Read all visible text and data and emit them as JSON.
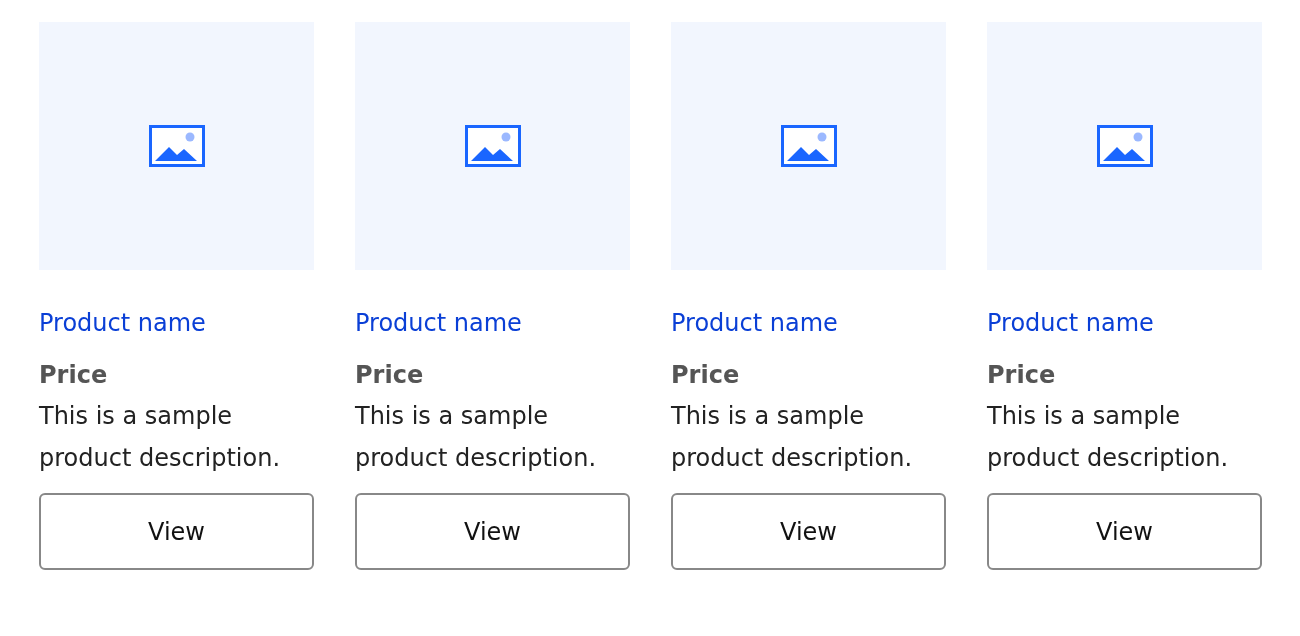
{
  "products": [
    {
      "name": "Product name",
      "price": "Price",
      "description": "This is a sample product description.",
      "button": "View"
    },
    {
      "name": "Product name",
      "price": "Price",
      "description": "This is a sample product description.",
      "button": "View"
    },
    {
      "name": "Product name",
      "price": "Price",
      "description": "This is a sample product description.",
      "button": "View"
    },
    {
      "name": "Product name",
      "price": "Price",
      "description": "This is a sample product description.",
      "button": "View"
    }
  ]
}
